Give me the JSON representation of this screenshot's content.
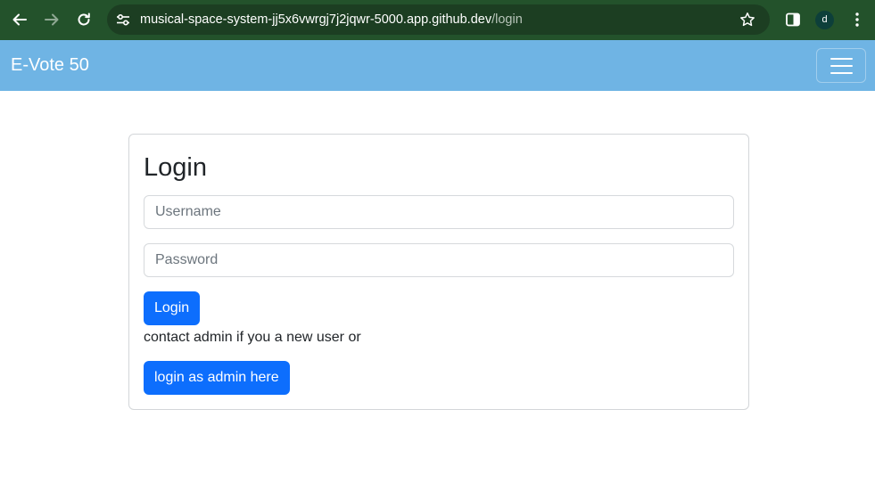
{
  "browser": {
    "url_host": "musical-space-system-jj5x6vwrgj7j2jqwr-5000.app.github.dev",
    "url_path": "/login",
    "profile_initial": "d",
    "colors": {
      "toolbar": "#23522b",
      "omnibox": "#1c3e22"
    }
  },
  "navbar": {
    "brand": "E-Vote 50",
    "color": "#6fb4e4"
  },
  "login": {
    "title": "Login",
    "username_placeholder": "Username",
    "password_placeholder": "Password",
    "username_value": "",
    "password_value": "",
    "login_button": "Login",
    "note": "contact admin if you a new user or",
    "admin_button": "login as admin here",
    "accent": "#0d6efd"
  }
}
